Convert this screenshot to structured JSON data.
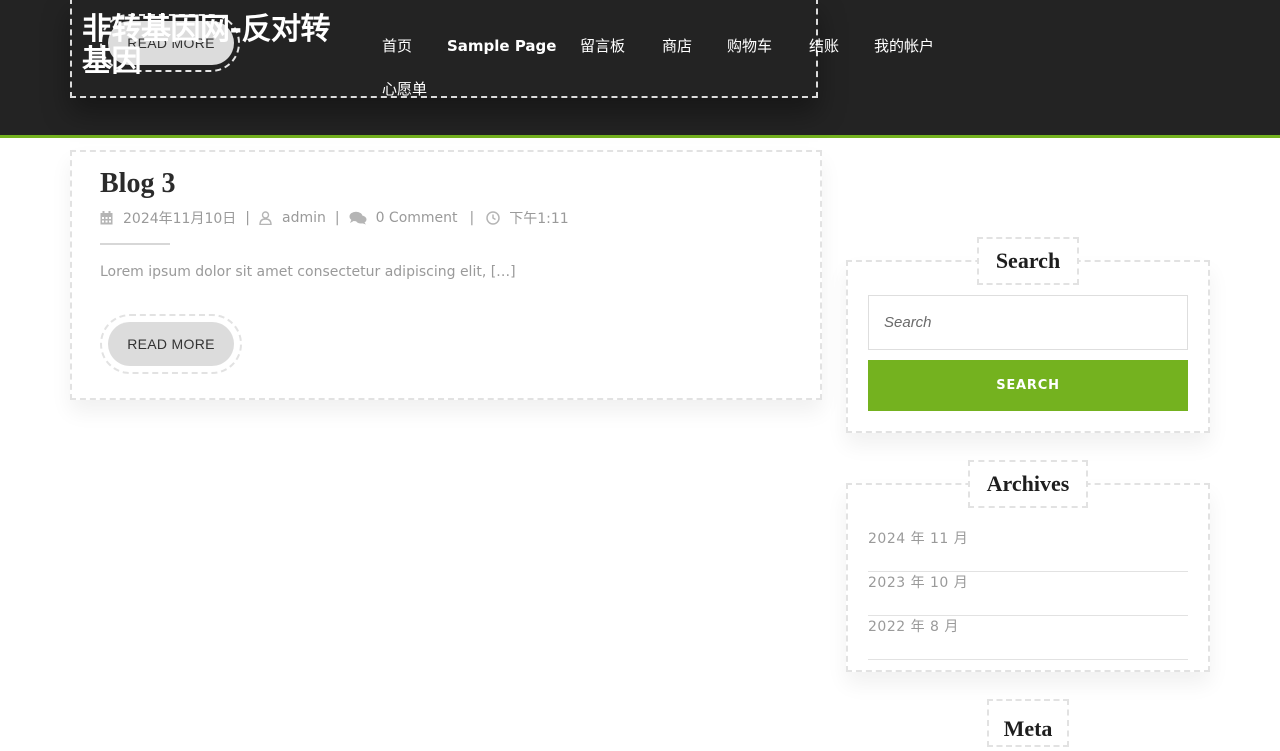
{
  "site": {
    "title": "非转基因网-反对转基因",
    "overlay_button": "READ MORE"
  },
  "nav": {
    "items": [
      {
        "label": "首页"
      },
      {
        "label": "Sample Page"
      },
      {
        "label": "留言板"
      },
      {
        "label": "商店"
      },
      {
        "label": "购物车"
      },
      {
        "label": "结账"
      },
      {
        "label": "我的帐户"
      },
      {
        "label": "心愿单"
      }
    ]
  },
  "post": {
    "title": "Blog 3",
    "date": "2024年11月10日",
    "author": "admin",
    "comments": "0 Comment",
    "time": "下午1:11",
    "separator": "|",
    "excerpt": "Lorem ipsum dolor sit amet consectetur adipiscing elit, […]",
    "read_more": "READ MORE"
  },
  "sidebar": {
    "search": {
      "title": "Search",
      "placeholder": "Search",
      "button": "SEARCH"
    },
    "archives": {
      "title": "Archives",
      "items": [
        "2024 年 11 月",
        "2023 年 10 月",
        "2022 年 8 月"
      ]
    },
    "meta": {
      "title": "Meta"
    }
  },
  "colors": {
    "header_bg": "#232323",
    "accent": "#74b21f",
    "text_muted": "#9a9a9a"
  },
  "icons": {
    "date": "calendar-icon",
    "author": "user-icon",
    "comments": "comments-icon",
    "time": "clock-icon"
  }
}
